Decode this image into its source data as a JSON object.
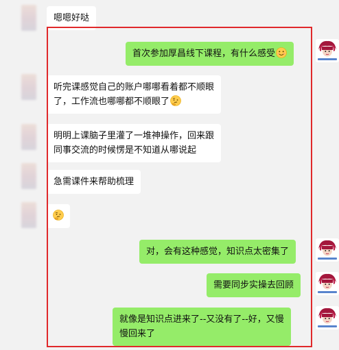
{
  "messages": [
    {
      "side": "left",
      "text": "嗯嗯好哒"
    },
    {
      "side": "right",
      "text": "首次参加厚昌线下课程，有什么感受",
      "emoji": "smile-emoji"
    },
    {
      "side": "left",
      "line1": "听完课感觉自己的账户哪哪看着都不顺眼",
      "line2": "了，工作流也哪哪都不顺眼了",
      "emoji": "thinking-emoji"
    },
    {
      "side": "left",
      "line1": "明明上课脑子里灌了一堆神操作，回来跟",
      "line2": "同事交流的时候愣是不知道从哪说起"
    },
    {
      "side": "left",
      "text": "急需课件来帮助梳理"
    },
    {
      "side": "left",
      "emoji": "thinking-emoji"
    },
    {
      "side": "right",
      "text": "对，会有这种感觉，知识点太密集了"
    },
    {
      "side": "right",
      "text": "需要同步实操去回顾"
    },
    {
      "side": "right",
      "line1": "就像是知识点进来了--又没有了--好，又慢",
      "line2": "慢回来了"
    }
  ],
  "colors": {
    "background": "#f2f2f2",
    "left_bubble": "#ffffff",
    "right_bubble": "#95ec69",
    "highlight_border": "#e0282a"
  }
}
